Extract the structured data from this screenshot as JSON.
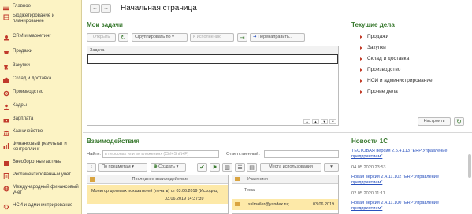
{
  "sidebar": {
    "items": [
      {
        "label": "Главное",
        "icon": "menu-icon"
      },
      {
        "label": "Бюджетирование и планирование",
        "icon": "budget-icon"
      },
      {
        "label": "CRM и маркетинг",
        "icon": "crm-icon"
      },
      {
        "label": "Продажи",
        "icon": "sales-icon"
      },
      {
        "label": "Закупки",
        "icon": "purchases-icon"
      },
      {
        "label": "Склад и доставка",
        "icon": "warehouse-icon"
      },
      {
        "label": "Производство",
        "icon": "production-icon"
      },
      {
        "label": "Кадры",
        "icon": "hr-icon"
      },
      {
        "label": "Зарплата",
        "icon": "salary-icon"
      },
      {
        "label": "Казначейство",
        "icon": "treasury-icon"
      },
      {
        "label": "Финансовый результат и контроллинг",
        "icon": "finance-icon"
      },
      {
        "label": "Внеоборотные активы",
        "icon": "assets-icon"
      },
      {
        "label": "Регламентированный учет",
        "icon": "accounting-icon"
      },
      {
        "label": "Международный финансовый учет",
        "icon": "intl-finance-icon"
      },
      {
        "label": "НСИ и администрирование",
        "icon": "admin-icon"
      }
    ]
  },
  "header": {
    "title": "Начальная страница",
    "back": "←",
    "forward": "→"
  },
  "tasks": {
    "title": "Мои задачи",
    "open": "Открыть",
    "group": "Сгруппировать по",
    "execute": "К исполнению",
    "redirect": "Перенаправить...",
    "column": "Задача"
  },
  "current": {
    "title": "Текущие дела",
    "items": [
      "Продажи",
      "Закупки",
      "Склад и доставка",
      "Производство",
      "НСИ и администрирование",
      "Прочие дела"
    ],
    "configure": "Настроить"
  },
  "interactions": {
    "title": "Взаимодействия",
    "find_label": "Найти:",
    "find_placeholder": "в персонах или во вложениях (Ctrl+Shift+F)",
    "responsible_label": "Ответственный:",
    "by_subject": "По предметам",
    "create": "Создать",
    "places": "Места использования",
    "col_last": "Последнее взаимодействие",
    "row_text": "Монитор целевых показателей (печать) от 03.06.2019 (Исходящ",
    "row_date": "03.06.2019 14:37:39",
    "col_participants": "Участники",
    "col_subject": "Тема",
    "participant": "sslmailer@yandex.ru;",
    "participant_date": "03.06.2019"
  },
  "news": {
    "title": "Новости 1С",
    "items": [
      {
        "text": "ТЕСТОВАЯ версия 2.5.4.113 \"ERP Управление предприятием\"",
        "date": "04.05.2020 23:53"
      },
      {
        "text": "Новая версия 2.4.11.102 \"ERP Управление предприятием\"",
        "date": "02.05.2020 11:11"
      },
      {
        "text": "Новая версия 2.4.11.100 \"ERP Управление предприятием\"",
        "date": ""
      }
    ]
  },
  "colors": {
    "accent_green": "#3a7a30",
    "sidebar_bg": "#fcf3c4",
    "link": "#2a52be",
    "highlight_row": "#fde9a8"
  }
}
